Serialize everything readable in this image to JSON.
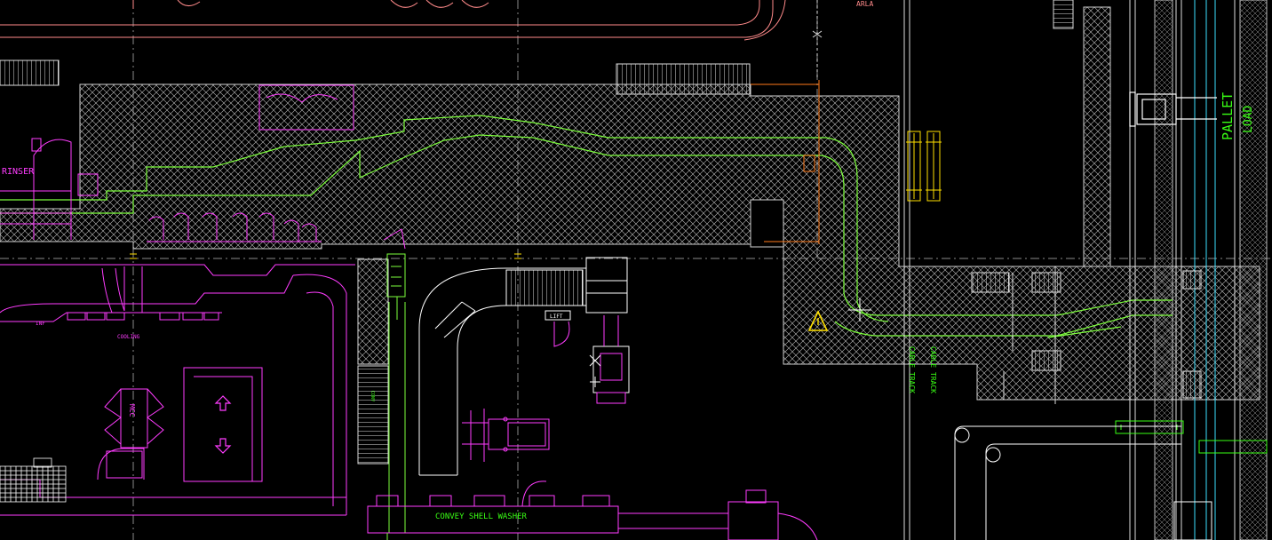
{
  "labels": {
    "arla": "ARLA",
    "rinser": "RINSER",
    "pallet": "PALLET",
    "load": "LOAD",
    "lift": "LIFT",
    "cooling": "COOLING",
    "inf": "INF",
    "mcc": "MCC",
    "conv_shell_washer": "CONVEY SHELL WASHER",
    "cable_track_1": "CABLE TRACK",
    "cable_track_2": "CABLE TRACK",
    "small_conv": "CONV"
  },
  "colors": {
    "background": "#000000",
    "hatch": "#cfcfcf",
    "magenta": "#ff3cff",
    "green": "#7dff3c",
    "bright_green": "#39ff14",
    "orange": "#ff7a1a",
    "white": "#ffffff",
    "cyan": "#3ce0ff",
    "yellow": "#ffe000",
    "grey_dash": "#9a9a9a",
    "salmon": "#ff8a8a"
  },
  "icons": [
    "warning-triangle-icon",
    "crosshair-cursor-icon",
    "arrow-up-icon",
    "arrow-down-icon"
  ]
}
